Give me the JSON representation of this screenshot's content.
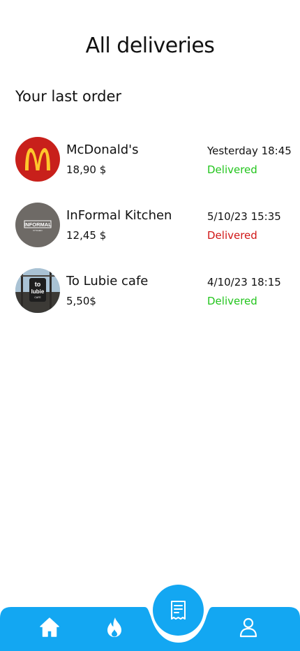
{
  "colors": {
    "accent": "#13A7F2",
    "delivered": "#22C51C",
    "failed": "#D01515"
  },
  "header": {
    "title": "All deliveries"
  },
  "section": {
    "title": "Your last order"
  },
  "orders": [
    {
      "name": "McDonald's",
      "price": "18,90 $",
      "date": "Yesterday 18:45",
      "status": "Delivered",
      "status_color": "green",
      "logo": "mcdonalds-logo"
    },
    {
      "name": "InFormal Kitchen",
      "price": "12,45 $",
      "date": "5/10/23 15:35",
      "status": "Delivered",
      "status_color": "red",
      "logo": "informal-kitchen-logo",
      "logo_text": "INFORMAL",
      "logo_subtext": "KITCHEN"
    },
    {
      "name": "To Lubie cafe",
      "price": "5,50$",
      "date": "4/10/23 18:15",
      "status": "Delivered",
      "status_color": "green",
      "logo": "to-lubie-cafe-photo",
      "logo_text_top": "to",
      "logo_text_mid": "lubie",
      "logo_text_bot": "CAFE"
    }
  ],
  "nav": {
    "items": [
      {
        "icon": "home-icon"
      },
      {
        "icon": "fire-icon"
      },
      {
        "icon": "receipt-icon",
        "active": true
      },
      {
        "icon": "profile-icon"
      }
    ]
  }
}
